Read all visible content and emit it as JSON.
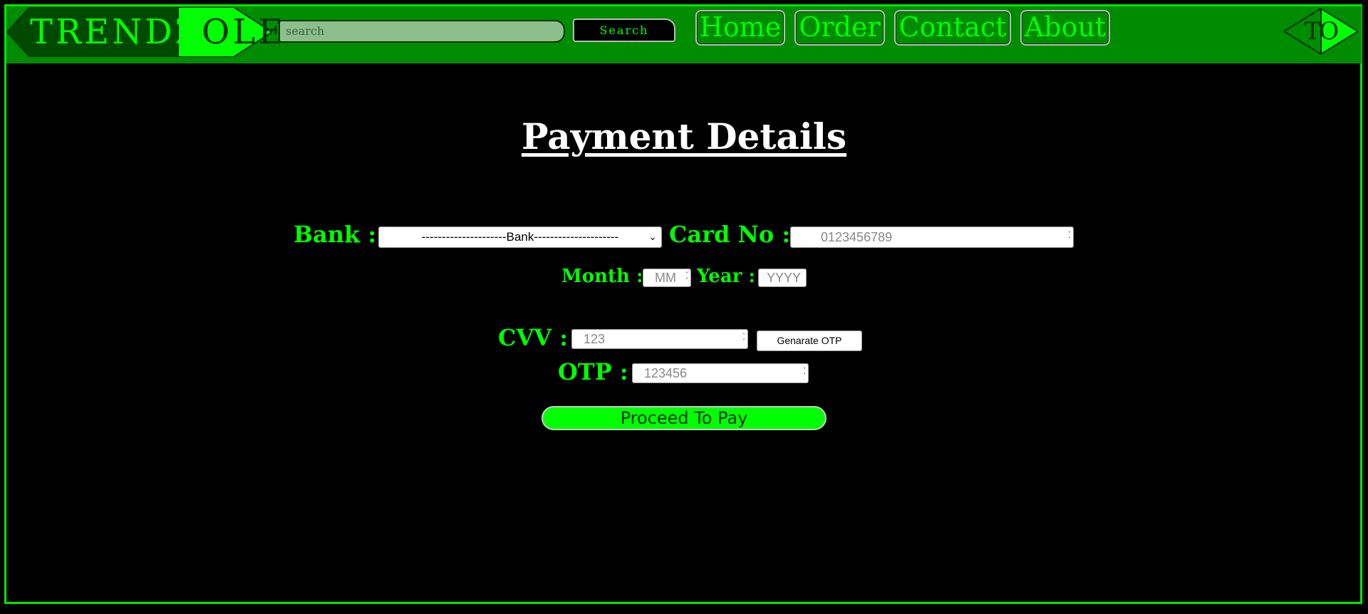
{
  "brand": {
    "part1": "TRENDZ",
    "part2": "OLE",
    "corner_logo": "TO"
  },
  "search": {
    "placeholder": "search",
    "button_label": "Search"
  },
  "nav": [
    "Home",
    "Order",
    "Contact",
    "About"
  ],
  "main": {
    "title": "Payment Details",
    "bank_label": "Bank :",
    "bank_selected": "---------------------Bank---------------------",
    "card_label": "Card No :",
    "card_placeholder": "0123456789",
    "month_label": "Month :",
    "month_placeholder": "MM",
    "year_label": "Year :",
    "year_placeholder": "YYYY",
    "cvv_label": "CVV :",
    "cvv_placeholder": "123",
    "generate_otp_label": "Genarate OTP",
    "otp_label": "OTP :",
    "otp_placeholder": "123456",
    "pay_label": "Proceed To Pay"
  },
  "colors": {
    "accent": "#00ff00",
    "navbar": "#008c00",
    "background": "#000000"
  },
  "icons": {
    "select_arrow": "chevron-down-icon",
    "number_spinner": "spinner-arrows-icon"
  }
}
